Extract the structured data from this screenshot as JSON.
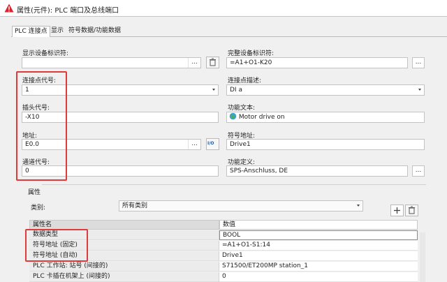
{
  "window": {
    "title": "属性(元件): PLC 端口及总线端口"
  },
  "tabs": [
    {
      "label": "PLC 连接点"
    },
    {
      "label": "显示"
    },
    {
      "label": "符号数据/功能数据"
    }
  ],
  "fields": {
    "display_device_tag": {
      "label": "显示设备标识符:",
      "value": ""
    },
    "full_device_tag": {
      "label": "完整设备标识符:",
      "value": "=A1+O1-K20"
    },
    "connection_point_code": {
      "label": "连接点代号:",
      "value": "1"
    },
    "connection_point_desc": {
      "label": "连接点描述:",
      "value": "DI a"
    },
    "plug_code": {
      "label": "插头代号:",
      "value": "-X10"
    },
    "function_text": {
      "label": "功能文本:",
      "value": "Motor drive on"
    },
    "address": {
      "label": "地址:",
      "value": "E0.0"
    },
    "symbol_address": {
      "label": "符号地址:",
      "value": "Drive1"
    },
    "channel_code": {
      "label": "通道代号:",
      "value": "0"
    },
    "function_definition": {
      "label": "功能定义:",
      "value": "SPS-Anschluss, DE"
    }
  },
  "buttons": {
    "dots": "...",
    "io": "I/O"
  },
  "properties": {
    "group_label": "属性",
    "category_label": "类别:",
    "category_value": "所有类别",
    "columns": [
      "属性名",
      "数值"
    ],
    "rows": [
      {
        "name": "数据类型",
        "value": "BOOL"
      },
      {
        "name": "符号地址 (固定)",
        "value": "=A1+O1-S1:14"
      },
      {
        "name": "符号地址 (自动)",
        "value": "Drive1"
      },
      {
        "name": "PLC 工作站: 站号 (间接的)",
        "value": "S71500/ET200MP station_1"
      },
      {
        "name": "PLC 卡插在机架上 (间接的)",
        "value": "0"
      }
    ]
  },
  "colors": {
    "highlight": "#e03a3a",
    "warning": "#d9232e"
  }
}
